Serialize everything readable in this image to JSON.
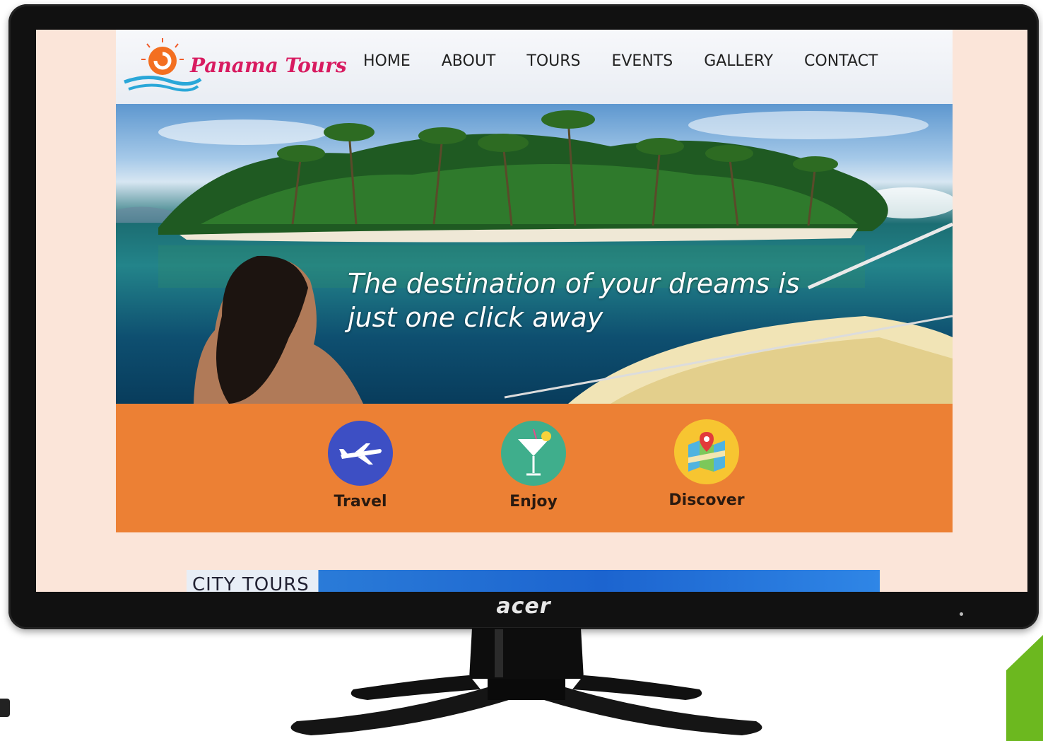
{
  "monitor": {
    "brand": "acer"
  },
  "site": {
    "logo_text": "Panama Tours",
    "nav": [
      "HOME",
      "ABOUT",
      "TOURS",
      "EVENTS",
      "GALLERY",
      "CONTACT"
    ],
    "hero": {
      "headline": "The destination of your dreams is just one click away"
    },
    "features": [
      {
        "label": "Travel",
        "icon": "airplane-icon",
        "color": "#3d4fc4"
      },
      {
        "label": "Enjoy",
        "icon": "cocktail-icon",
        "color": "#3fae8c"
      },
      {
        "label": "Discover",
        "icon": "map-pin-icon",
        "color": "#f7c531"
      }
    ],
    "section_preview": "CITY TOURS"
  },
  "colors": {
    "accent_orange": "#ec8034",
    "page_bg": "#fbe5d9",
    "logo_pink": "#d81b60",
    "corner_green": "#6cb81f"
  }
}
